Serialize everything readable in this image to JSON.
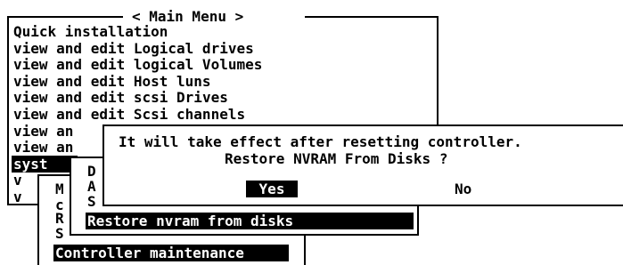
{
  "main_menu": {
    "title": "< Main Menu >",
    "items": [
      {
        "pre": "",
        "hot": "Q",
        "post": "uick installation"
      },
      {
        "pre": "view and edit ",
        "hot": "L",
        "post": "ogical drives"
      },
      {
        "pre": "view and edit logical ",
        "hot": "V",
        "post": "olumes"
      },
      {
        "pre": "view and edit ",
        "hot": "H",
        "post": "ost luns"
      },
      {
        "pre": "view and edit scsi ",
        "hot": "D",
        "post": "rives"
      },
      {
        "pre": "view and edit ",
        "hot": "S",
        "post": "csi channels"
      },
      {
        "pre": "view an",
        "hot": "",
        "post": ""
      },
      {
        "pre": "view an",
        "hot": "",
        "post": ""
      },
      {
        "pre": "syst",
        "hot": "",
        "post": ""
      },
      {
        "pre": "v",
        "hot": "",
        "post": ""
      },
      {
        "pre": "v",
        "hot": "",
        "post": ""
      }
    ]
  },
  "system_submenu": {
    "letters_outer": [
      "M",
      "c",
      "R",
      "S"
    ],
    "letters_inner": [
      "D",
      "A",
      "S"
    ],
    "highlighted": "Controller maintenance"
  },
  "maintenance_submenu": {
    "highlighted": "Restore nvram from disks"
  },
  "confirm_dialog": {
    "message_line1": "It will take effect after resetting controller.",
    "message_line2": "Restore NVRAM From Disks ?",
    "yes_label": "Yes",
    "no_label": "No"
  }
}
